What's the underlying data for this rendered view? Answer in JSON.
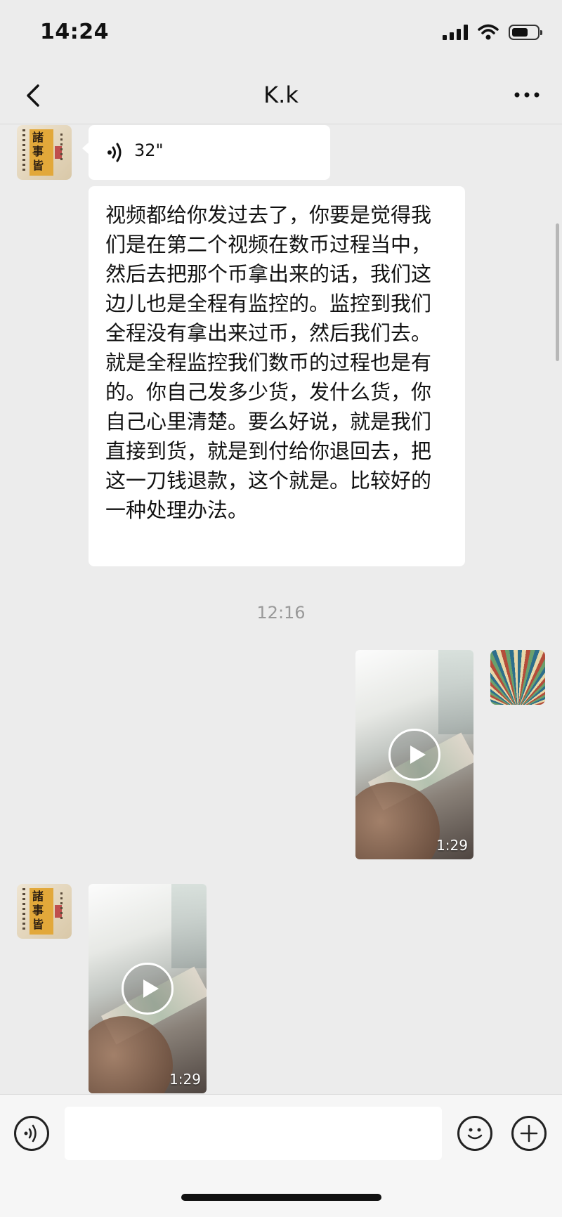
{
  "status_bar": {
    "time": "14:24"
  },
  "nav": {
    "title": "K.k"
  },
  "messages": {
    "voice": {
      "duration": "32\""
    },
    "text": "视频都给你发过去了，你要是觉得我们是在第二个视频在数币过程当中，然后去把那个币拿出来的话，我们这边儿也是全程有监控的。监控到我们全程没有拿出来过币，然后我们去。就是全程监控我们数币的过程也是有的。你自己发多少货，发什么货，你自己心里清楚。要么好说，就是我们直接到货，就是到付给你退回去，把这一刀钱退款，这个就是。比较好的一种处理办法。",
    "timestamp": "12:16",
    "video_sent": {
      "duration": "1:29"
    },
    "video_received": {
      "duration": "1:29"
    }
  },
  "icons": {
    "back": "chevron-left-icon",
    "more": "more-dots-icon",
    "voice": "voice-wave-icon",
    "emoji": "smiley-icon",
    "plus": "plus-icon",
    "play": "play-icon"
  },
  "colors": {
    "background": "#ececec",
    "bubble": "#ffffff",
    "timestamp": "#999999"
  }
}
